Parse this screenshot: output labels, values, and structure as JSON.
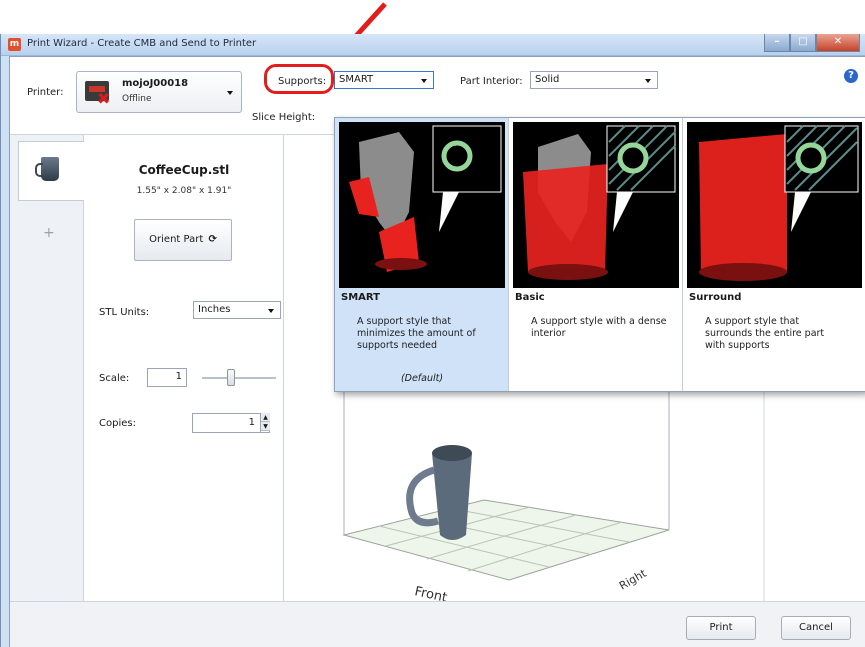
{
  "window": {
    "title": "Print Wizard - Create CMB and Send to Printer",
    "app_icon_glyph": "m",
    "controls": {
      "minimize": "–",
      "maximize": "□",
      "close": "✕"
    }
  },
  "toolbar": {
    "printer_label": "Printer:",
    "printer_name": "mojoJ00018",
    "printer_status": "Offline",
    "supports_label": "Supports:",
    "supports_value": "SMART",
    "part_interior_label": "Part Interior:",
    "part_interior_value": "Solid",
    "slice_height_label": "Slice Height:",
    "help_glyph": "?"
  },
  "part_panel": {
    "name": "CoffeeCup.stl",
    "dimensions": "1.55\" x 2.08\" x 1.91\"",
    "orient_label": "Orient Part",
    "refresh_glyph": "⟳",
    "stl_units_label": "STL Units:",
    "stl_units_value": "Inches",
    "scale_label": "Scale:",
    "scale_value": "1",
    "copies_label": "Copies:",
    "copies_value": "1",
    "add_tab_glyph": "+"
  },
  "support_options": [
    {
      "name": "SMART",
      "description": "A support style that minimizes the amount of supports needed",
      "note": "(Default)",
      "selected": true
    },
    {
      "name": "Basic",
      "description": "A support style with a dense interior",
      "selected": false
    },
    {
      "name": "Surround",
      "description": "A support style that surrounds the entire part with supports",
      "selected": false
    }
  ],
  "viewport": {
    "front_label": "Front",
    "right_label": "Right"
  },
  "footer": {
    "print_label": "Print",
    "cancel_label": "Cancel"
  },
  "colors": {
    "annotation": "#e31c1c",
    "selected_option": "#cfe2f8",
    "support_red": "#e8231f",
    "mug": "#5c6b7c"
  }
}
